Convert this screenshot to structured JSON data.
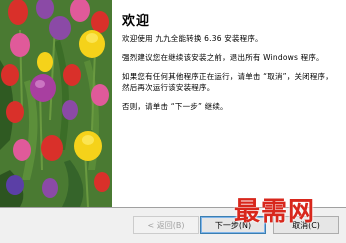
{
  "welcome": {
    "title": "欢迎",
    "paragraphs": [
      "欢迎使用 九九全能转换 6.36 安装程序。",
      "强烈建议您在继续该安装之前，退出所有 Windows 程序。",
      "如果您有任何其他程序正在运行，请单击 “取消”，关闭程序，然后再次运行该安装程序。",
      "否则，请单击 “下一步” 继续。"
    ]
  },
  "buttons": {
    "back": "< 返回(B)",
    "next": "下一步(N)",
    "cancel": "取消(C)"
  },
  "watermark": "最需网",
  "colors": {
    "watermark": "#d8271c",
    "tulip_red": "#d9302a",
    "tulip_yellow": "#f5d21a",
    "tulip_purple": "#8b4aa6",
    "tulip_pink": "#e05a9a",
    "foliage": "#3e6a2a"
  }
}
